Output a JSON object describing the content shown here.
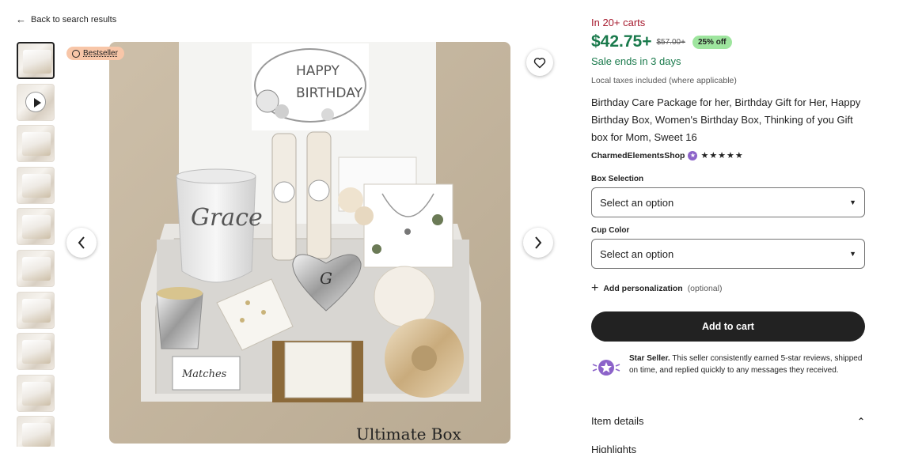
{
  "nav": {
    "back_label": "Back to search results"
  },
  "gallery": {
    "thumbnail_count": 10,
    "badge": "Bestseller",
    "caption": "Ultimate Box",
    "card_text": {
      "line1": "HAPPY",
      "line2": "BIRTHDAY"
    },
    "cup_name": "Grace",
    "dish_letter": "G",
    "matches_label": "Matches"
  },
  "listing": {
    "in_carts": "In 20+ carts",
    "price": "$42.75+",
    "original_price": "$57.00+",
    "discount": "25% off",
    "sale_ends": "Sale ends in 3 days",
    "taxes": "Local taxes included (where applicable)",
    "title": "Birthday Care Package for her, Birthday Gift for Her, Happy Birthday Box, Women's Birthday Box, Thinking of you Gift box for Mom, Sweet 16",
    "shop_name": "CharmedElementsShop",
    "rating_stars": "★★★★★",
    "rating": 5
  },
  "options": {
    "box_label": "Box Selection",
    "box_value": "Select an option",
    "cup_label": "Cup Color",
    "cup_value": "Select an option"
  },
  "personalization": {
    "label": "Add personalization",
    "optional": "(optional)"
  },
  "cart": {
    "button_label": "Add to cart"
  },
  "star_seller": {
    "title": "Star Seller.",
    "text": "This seller consistently earned 5-star reviews, shipped on time, and replied quickly to any messages they received."
  },
  "details": {
    "item_details": "Item details",
    "highlights": "Highlights"
  },
  "colors": {
    "price_green": "#1a7a4c",
    "cart_red": "#a61a2e",
    "badge_peach": "#f8c6a8",
    "discount_green": "#9ee59e",
    "star_purple": "#8c63c9",
    "button_dark": "#222222"
  }
}
